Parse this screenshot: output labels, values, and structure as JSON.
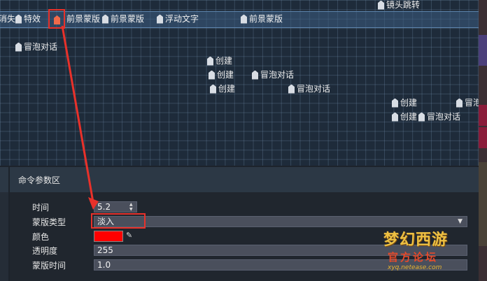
{
  "timeline": {
    "track_row": [
      {
        "label": "消失"
      },
      {
        "label": "特效"
      },
      {
        "label": "前景蒙版"
      },
      {
        "label": "前景蒙版"
      },
      {
        "label": "浮动文字"
      },
      {
        "label": "前景蒙版"
      }
    ],
    "top_label": "镜头跳转",
    "events": [
      {
        "label": "冒泡对话"
      },
      {
        "label": "创建"
      },
      {
        "label": "创建"
      },
      {
        "label": "冒泡对话"
      },
      {
        "label": "创建"
      },
      {
        "label": "冒泡对话"
      },
      {
        "label": "创建"
      },
      {
        "label": "冒泡"
      },
      {
        "label": "创建"
      },
      {
        "label": "冒泡对话"
      }
    ]
  },
  "params": {
    "header": "命令参数区",
    "time_label": "时间",
    "time_value": "5.2",
    "mask_type_label": "蒙版类型",
    "mask_type_value": "淡入",
    "color_label": "颜色",
    "color_value": "#ff0000",
    "opacity_label": "透明度",
    "opacity_value": "255",
    "mask_time_label": "蒙版时间",
    "mask_time_value": "1.0"
  },
  "colors": {
    "accent_red": "#e8312a",
    "grid_bg": "#1e2b3a",
    "panel_bg": "#20262e"
  },
  "icons": {
    "event_marker": "event-marker-icon",
    "dropdown": "chevron-down-icon",
    "eyedropper": "eyedropper-icon"
  }
}
